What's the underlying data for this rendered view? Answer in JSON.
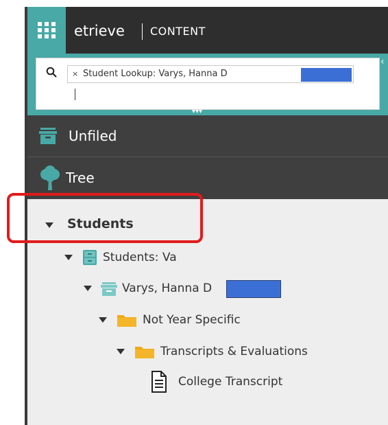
{
  "header": {
    "brand": "etrieve",
    "product": "CONTENT"
  },
  "search": {
    "token_remove": "×",
    "token_text": "Student Lookup: Varys, Hanna D"
  },
  "nav": {
    "unfiled_label": "Unfiled",
    "tree_label": "Tree"
  },
  "tree": {
    "root": "Students",
    "nodes": [
      {
        "label": "Students: Va",
        "icon": "cabinet-icon"
      },
      {
        "label": "Varys, Hanna D",
        "icon": "drawer-icon"
      },
      {
        "label": "Not Year Specific",
        "icon": "folder-icon"
      },
      {
        "label": "Transcripts & Evaluations",
        "icon": "folder-icon"
      },
      {
        "label": "College Transcript",
        "icon": "document-icon"
      }
    ]
  },
  "colors": {
    "accent": "#48a9a6",
    "header": "#2e2e2e",
    "nav": "#3f3f3f",
    "highlight": "#e21b1b",
    "redaction": "#3c6fd6",
    "folder": "#f0a818"
  }
}
